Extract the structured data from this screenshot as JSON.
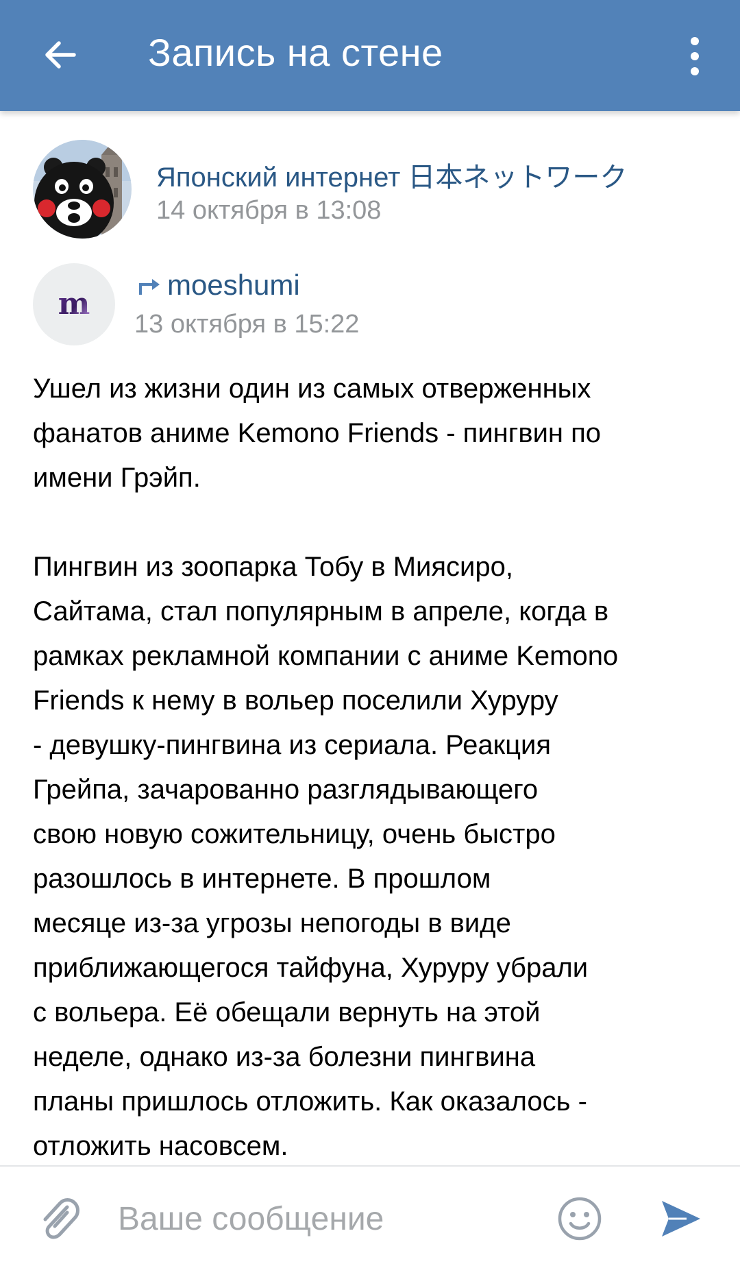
{
  "header": {
    "title": "Запись на стене",
    "back_icon": "arrow-left-icon",
    "menu_icon": "more-vertical-icon",
    "background_color": "#5282b8"
  },
  "post": {
    "author": "Японский интернет 日本ネットワーク",
    "date": "14 октября в 13:08",
    "avatar_icon": "kumamon-avatar"
  },
  "repost": {
    "author": "moeshumi",
    "date": "13 октября в 15:22",
    "repost_icon": "repost-arrow-icon",
    "avatar_icon": "moeshumi-logo",
    "avatar_letter": "m"
  },
  "body": {
    "paragraph1": [
      "Ушел из жизни один из самых отверженных",
      "фанатов аниме Kemono Friends - пингвин по",
      "имени Грэйп."
    ],
    "paragraph2": [
      "Пингвин из зоопарка Тобу в Миясиро,",
      "Сайтама, стал популярным в апреле, когда в",
      "рамках рекламной компании с аниме Kemono",
      "Friends к нему в вольер поселили Хуруру",
      "- девушку-пингвина из сериала. Реакция",
      "Грейпа, зачарованно разглядывающего",
      "свою новую сожительницу, очень быстро",
      "разошлось в интернете. В прошлом",
      "месяце из-за угрозы непогоды в виде",
      "приближающегося тайфуна, Хуруру убрали",
      "с вольера. Её обещали вернуть на этой",
      "неделе, однако из-за болезни пингвина",
      "планы пришлось отложить. Как оказалось -",
      "отложить насовсем."
    ]
  },
  "composer": {
    "placeholder": "Ваше сообщение",
    "attach_icon": "paperclip-icon",
    "emoji_icon": "smiley-icon",
    "send_icon": "send-icon",
    "accent_color": "#5181b8"
  }
}
